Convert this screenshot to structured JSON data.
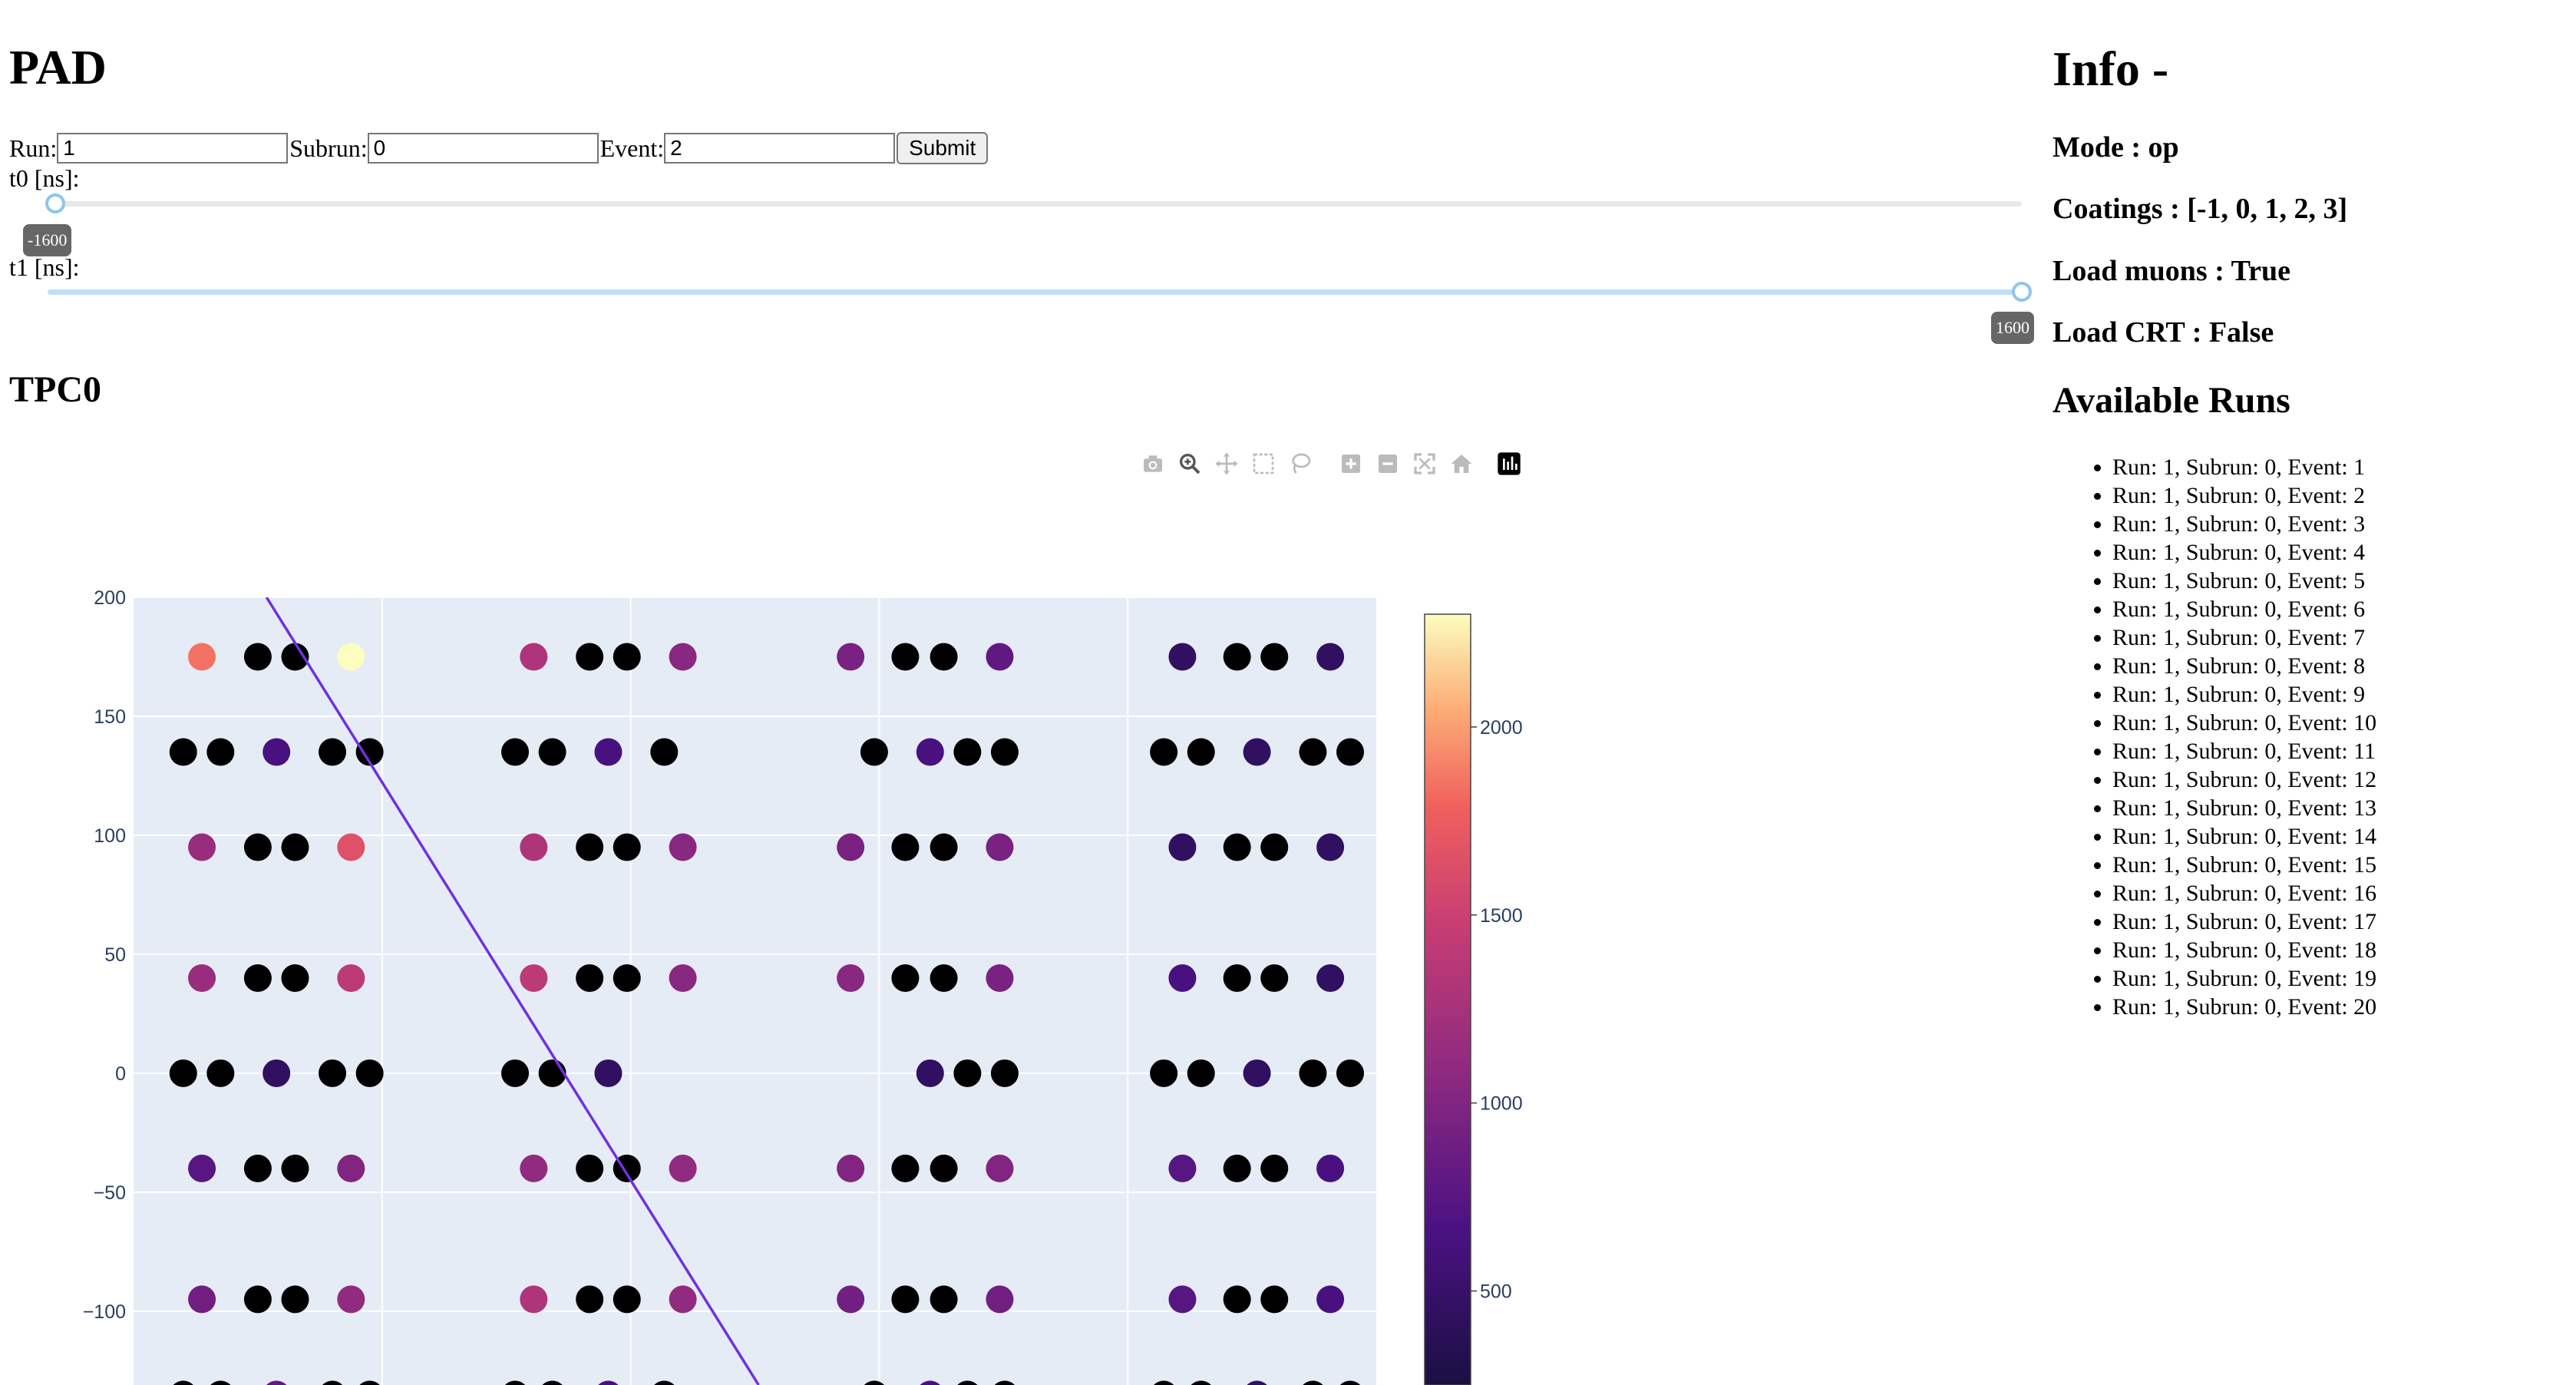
{
  "left": {
    "title": "PAD",
    "form": {
      "run_label": "Run:",
      "run_value": "1",
      "subrun_label": "Subrun:",
      "subrun_value": "0",
      "event_label": "Event:",
      "event_value": "2",
      "submit_label": "Submit"
    },
    "t0": {
      "label": "t0 [ns]:",
      "value": "-1600",
      "min": -1600,
      "max": 1600
    },
    "t1": {
      "label": "t1 [ns]:",
      "value": "1600",
      "min": -1600,
      "max": 1600
    },
    "plot_title": "TPC0",
    "modebar": [
      "camera-icon",
      "zoom-icon",
      "pan-icon",
      "box-select-icon",
      "lasso-select-icon",
      "zoom-in-icon",
      "zoom-out-icon",
      "autoscale-icon",
      "reset-axes-icon",
      "plotly-logo-icon"
    ]
  },
  "right": {
    "info_title": "Info -",
    "mode": "Mode : op",
    "coatings": "Coatings : [-1, 0, 1, 2, 3]",
    "load_muons": "Load muons : True",
    "load_crt": "Load CRT : False",
    "runs_title": "Available Runs",
    "runs": [
      "Run: 1, Subrun: 0, Event: 1",
      "Run: 1, Subrun: 0, Event: 2",
      "Run: 1, Subrun: 0, Event: 3",
      "Run: 1, Subrun: 0, Event: 4",
      "Run: 1, Subrun: 0, Event: 5",
      "Run: 1, Subrun: 0, Event: 6",
      "Run: 1, Subrun: 0, Event: 7",
      "Run: 1, Subrun: 0, Event: 8",
      "Run: 1, Subrun: 0, Event: 9",
      "Run: 1, Subrun: 0, Event: 10",
      "Run: 1, Subrun: 0, Event: 11",
      "Run: 1, Subrun: 0, Event: 12",
      "Run: 1, Subrun: 0, Event: 13",
      "Run: 1, Subrun: 0, Event: 14",
      "Run: 1, Subrun: 0, Event: 15",
      "Run: 1, Subrun: 0, Event: 16",
      "Run: 1, Subrun: 0, Event: 17",
      "Run: 1, Subrun: 0, Event: 18",
      "Run: 1, Subrun: 0, Event: 19",
      "Run: 1, Subrun: 0, Event: 20"
    ]
  },
  "colors": {
    "plot_bg": "#e5ecf6",
    "grid": "#ffffff",
    "track": "#7030e0",
    "zero_hit": "#000000",
    "slider_active": "#bfe0fa",
    "slider_inactive": "#e8e8e8",
    "tooltip": "#666666"
  },
  "chart_data": {
    "type": "scatter",
    "title": "",
    "yticks": [
      200,
      150,
      100,
      50,
      0,
      -50,
      -100
    ],
    "ylim": [
      -131,
      200
    ],
    "xlim": [
      0,
      100
    ],
    "grid": true,
    "colorscale": "magma",
    "colorbar": {
      "ticks": [
        2000,
        1500,
        1000,
        500
      ],
      "range": [
        250,
        2300
      ]
    },
    "points": [
      {
        "x": 5.5,
        "y": 175,
        "c": 1850
      },
      {
        "x": 10,
        "y": 175,
        "c": 0
      },
      {
        "x": 13,
        "y": 175,
        "c": 0
      },
      {
        "x": 17.5,
        "y": 175,
        "c": 2300
      },
      {
        "x": 32.2,
        "y": 175,
        "c": 1300
      },
      {
        "x": 36.7,
        "y": 175,
        "c": 0
      },
      {
        "x": 39.7,
        "y": 175,
        "c": 0
      },
      {
        "x": 44.2,
        "y": 175,
        "c": 1050
      },
      {
        "x": 57.7,
        "y": 175,
        "c": 950
      },
      {
        "x": 62.1,
        "y": 175,
        "c": 0
      },
      {
        "x": 65.2,
        "y": 175,
        "c": 0
      },
      {
        "x": 69.7,
        "y": 175,
        "c": 800
      },
      {
        "x": 84.4,
        "y": 175,
        "c": 450
      },
      {
        "x": 88.8,
        "y": 175,
        "c": 0
      },
      {
        "x": 91.8,
        "y": 175,
        "c": 0
      },
      {
        "x": 96.3,
        "y": 175,
        "c": 450
      },
      {
        "x": 4,
        "y": 135,
        "c": 0
      },
      {
        "x": 7,
        "y": 135,
        "c": 0
      },
      {
        "x": 11.5,
        "y": 135,
        "c": 650
      },
      {
        "x": 16,
        "y": 135,
        "c": 0
      },
      {
        "x": 19,
        "y": 135,
        "c": 0
      },
      {
        "x": 30.7,
        "y": 135,
        "c": 0
      },
      {
        "x": 33.7,
        "y": 135,
        "c": 0
      },
      {
        "x": 38.2,
        "y": 135,
        "c": 650
      },
      {
        "x": 42.7,
        "y": 135,
        "c": 0
      },
      {
        "x": 59.6,
        "y": 135,
        "c": 0
      },
      {
        "x": 64.1,
        "y": 135,
        "c": 650
      },
      {
        "x": 67.1,
        "y": 135,
        "c": 0
      },
      {
        "x": 70.1,
        "y": 135,
        "c": 0
      },
      {
        "x": 82.9,
        "y": 135,
        "c": 0
      },
      {
        "x": 85.9,
        "y": 135,
        "c": 0
      },
      {
        "x": 90.4,
        "y": 135,
        "c": 450
      },
      {
        "x": 94.9,
        "y": 135,
        "c": 0
      },
      {
        "x": 97.9,
        "y": 135,
        "c": 0
      },
      {
        "x": 5.5,
        "y": 95,
        "c": 1150
      },
      {
        "x": 10,
        "y": 95,
        "c": 0
      },
      {
        "x": 13,
        "y": 95,
        "c": 0
      },
      {
        "x": 17.5,
        "y": 95,
        "c": 1650
      },
      {
        "x": 32.2,
        "y": 95,
        "c": 1300
      },
      {
        "x": 36.7,
        "y": 95,
        "c": 0
      },
      {
        "x": 39.7,
        "y": 95,
        "c": 0
      },
      {
        "x": 44.2,
        "y": 95,
        "c": 1050
      },
      {
        "x": 57.7,
        "y": 95,
        "c": 950
      },
      {
        "x": 62.1,
        "y": 95,
        "c": 0
      },
      {
        "x": 65.2,
        "y": 95,
        "c": 0
      },
      {
        "x": 69.7,
        "y": 95,
        "c": 950
      },
      {
        "x": 84.4,
        "y": 95,
        "c": 450
      },
      {
        "x": 88.8,
        "y": 95,
        "c": 0
      },
      {
        "x": 91.8,
        "y": 95,
        "c": 0
      },
      {
        "x": 96.3,
        "y": 95,
        "c": 450
      },
      {
        "x": 5.5,
        "y": 40,
        "c": 1150
      },
      {
        "x": 10,
        "y": 40,
        "c": 0
      },
      {
        "x": 13,
        "y": 40,
        "c": 0
      },
      {
        "x": 17.5,
        "y": 40,
        "c": 1400
      },
      {
        "x": 32.2,
        "y": 40,
        "c": 1400
      },
      {
        "x": 36.7,
        "y": 40,
        "c": 0
      },
      {
        "x": 39.7,
        "y": 40,
        "c": 0
      },
      {
        "x": 44.2,
        "y": 40,
        "c": 1050
      },
      {
        "x": 57.7,
        "y": 40,
        "c": 1050
      },
      {
        "x": 62.1,
        "y": 40,
        "c": 0
      },
      {
        "x": 65.2,
        "y": 40,
        "c": 0
      },
      {
        "x": 69.7,
        "y": 40,
        "c": 950
      },
      {
        "x": 84.4,
        "y": 40,
        "c": 650
      },
      {
        "x": 88.8,
        "y": 40,
        "c": 0
      },
      {
        "x": 91.8,
        "y": 40,
        "c": 0
      },
      {
        "x": 96.3,
        "y": 40,
        "c": 450
      },
      {
        "x": 4,
        "y": 0,
        "c": 0
      },
      {
        "x": 7,
        "y": 0,
        "c": 0
      },
      {
        "x": 11.5,
        "y": 0,
        "c": 450
      },
      {
        "x": 16,
        "y": 0,
        "c": 0
      },
      {
        "x": 19,
        "y": 0,
        "c": 0
      },
      {
        "x": 30.7,
        "y": 0,
        "c": 0
      },
      {
        "x": 33.7,
        "y": 0,
        "c": 0
      },
      {
        "x": 38.2,
        "y": 0,
        "c": 450
      },
      {
        "x": 64.1,
        "y": 0,
        "c": 450
      },
      {
        "x": 67.1,
        "y": 0,
        "c": 0
      },
      {
        "x": 70.1,
        "y": 0,
        "c": 0
      },
      {
        "x": 82.9,
        "y": 0,
        "c": 0
      },
      {
        "x": 85.9,
        "y": 0,
        "c": 0
      },
      {
        "x": 90.4,
        "y": 0,
        "c": 450
      },
      {
        "x": 94.9,
        "y": 0,
        "c": 0
      },
      {
        "x": 97.9,
        "y": 0,
        "c": 0
      },
      {
        "x": 5.5,
        "y": -40,
        "c": 750
      },
      {
        "x": 10,
        "y": -40,
        "c": 0
      },
      {
        "x": 13,
        "y": -40,
        "c": 0
      },
      {
        "x": 17.5,
        "y": -40,
        "c": 1000
      },
      {
        "x": 32.2,
        "y": -40,
        "c": 1100
      },
      {
        "x": 36.7,
        "y": -40,
        "c": 0
      },
      {
        "x": 39.7,
        "y": -40,
        "c": 0
      },
      {
        "x": 44.2,
        "y": -40,
        "c": 1100
      },
      {
        "x": 57.7,
        "y": -40,
        "c": 1000
      },
      {
        "x": 62.1,
        "y": -40,
        "c": 0
      },
      {
        "x": 65.2,
        "y": -40,
        "c": 0
      },
      {
        "x": 69.7,
        "y": -40,
        "c": 1000
      },
      {
        "x": 84.4,
        "y": -40,
        "c": 750
      },
      {
        "x": 88.8,
        "y": -40,
        "c": 0
      },
      {
        "x": 91.8,
        "y": -40,
        "c": 0
      },
      {
        "x": 96.3,
        "y": -40,
        "c": 650
      },
      {
        "x": 5.5,
        "y": -95,
        "c": 900
      },
      {
        "x": 10,
        "y": -95,
        "c": 0
      },
      {
        "x": 13,
        "y": -95,
        "c": 0
      },
      {
        "x": 17.5,
        "y": -95,
        "c": 1100
      },
      {
        "x": 32.2,
        "y": -95,
        "c": 1300
      },
      {
        "x": 36.7,
        "y": -95,
        "c": 0
      },
      {
        "x": 39.7,
        "y": -95,
        "c": 0
      },
      {
        "x": 44.2,
        "y": -95,
        "c": 1100
      },
      {
        "x": 57.7,
        "y": -95,
        "c": 900
      },
      {
        "x": 62.1,
        "y": -95,
        "c": 0
      },
      {
        "x": 65.2,
        "y": -95,
        "c": 0
      },
      {
        "x": 69.7,
        "y": -95,
        "c": 900
      },
      {
        "x": 84.4,
        "y": -95,
        "c": 750
      },
      {
        "x": 88.8,
        "y": -95,
        "c": 0
      },
      {
        "x": 91.8,
        "y": -95,
        "c": 0
      },
      {
        "x": 96.3,
        "y": -95,
        "c": 650
      },
      {
        "x": 4,
        "y": -135,
        "c": 0
      },
      {
        "x": 7,
        "y": -135,
        "c": 0
      },
      {
        "x": 11.5,
        "y": -135,
        "c": 800
      },
      {
        "x": 16,
        "y": -135,
        "c": 0
      },
      {
        "x": 19,
        "y": -135,
        "c": 0
      },
      {
        "x": 30.7,
        "y": -135,
        "c": 0
      },
      {
        "x": 33.7,
        "y": -135,
        "c": 0
      },
      {
        "x": 38.2,
        "y": -135,
        "c": 650
      },
      {
        "x": 42.7,
        "y": -135,
        "c": 0
      },
      {
        "x": 59.6,
        "y": -135,
        "c": 0
      },
      {
        "x": 64.1,
        "y": -135,
        "c": 650
      },
      {
        "x": 67.1,
        "y": -135,
        "c": 0
      },
      {
        "x": 70.1,
        "y": -135,
        "c": 0
      },
      {
        "x": 82.9,
        "y": -135,
        "c": 0
      },
      {
        "x": 85.9,
        "y": -135,
        "c": 0
      },
      {
        "x": 90.4,
        "y": -135,
        "c": 450
      },
      {
        "x": 94.9,
        "y": -135,
        "c": 0
      },
      {
        "x": 97.9,
        "y": -135,
        "c": 0
      }
    ],
    "track": {
      "x": [
        10.7,
        50.3
      ],
      "y": [
        200,
        -131
      ]
    }
  }
}
